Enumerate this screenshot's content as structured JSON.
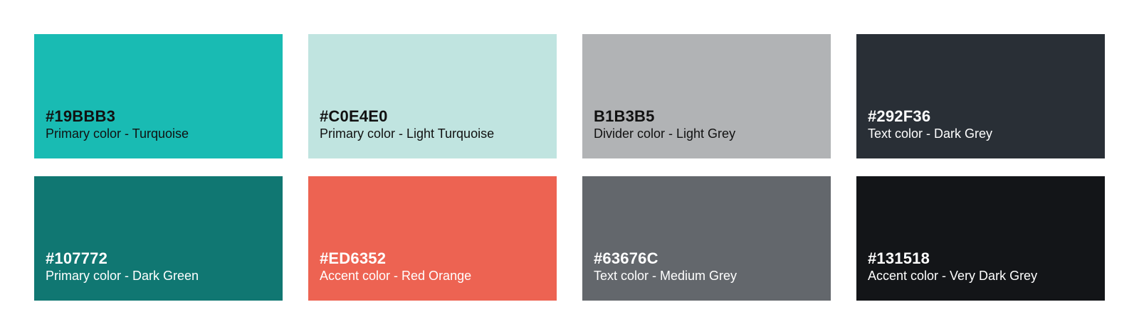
{
  "swatches": [
    {
      "code": "#19BBB3",
      "label": "Primary color - Turquoise",
      "color": "#19BBB3",
      "text_tone": "light"
    },
    {
      "code": "#C0E4E0",
      "label": "Primary color - Light Turquoise",
      "color": "#C0E4E0",
      "text_tone": "light"
    },
    {
      "code": "B1B3B5",
      "label": "Divider color - Light Grey",
      "color": "#B1B3B5",
      "text_tone": "light"
    },
    {
      "code": "#292F36",
      "label": "Text color - Dark Grey",
      "color": "#292F36",
      "text_tone": "dark"
    },
    {
      "code": "#107772",
      "label": "Primary color - Dark Green",
      "color": "#107772",
      "text_tone": "dark"
    },
    {
      "code": "#ED6352",
      "label": "Accent color - Red Orange",
      "color": "#ED6352",
      "text_tone": "dark"
    },
    {
      "code": "#63676C",
      "label": "Text color - Medium Grey",
      "color": "#63676C",
      "text_tone": "dark"
    },
    {
      "code": "#131518",
      "label": "Accent color - Very Dark Grey",
      "color": "#131518",
      "text_tone": "dark"
    }
  ]
}
